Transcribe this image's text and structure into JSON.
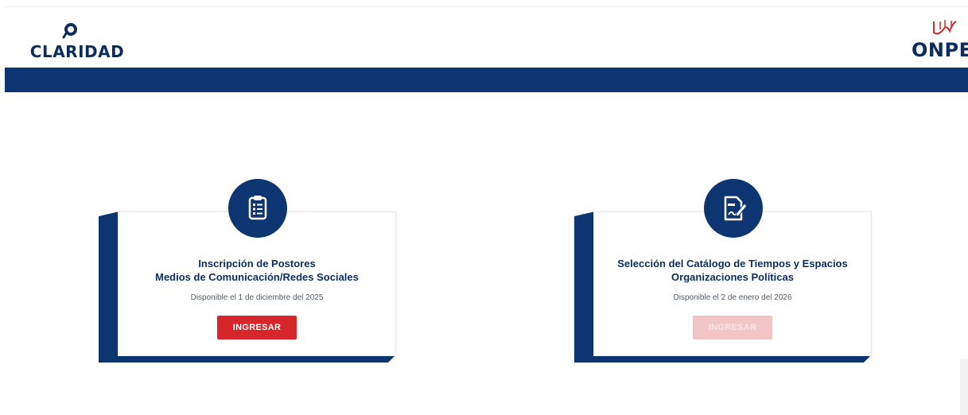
{
  "header": {
    "left_logo": {
      "text": "CLARIDAD",
      "icon": "magnifier-logo-icon"
    },
    "right_logo": {
      "text": "ONPE",
      "icon": "onpe-emblem-icon"
    }
  },
  "colors": {
    "navy": "#0d3572",
    "red": "#d7262b",
    "red_disabled": "#f3c4c6"
  },
  "cards": [
    {
      "icon": "clipboard-list-icon",
      "title_line1": "Inscripción de Postores",
      "title_line2": "Medios de Comunicación/Redes Sociales",
      "availability": "Disponible el 1 de diciembre del 2025",
      "button_label": "INGRESAR",
      "button_enabled": true
    },
    {
      "icon": "document-signature-icon",
      "title_line1": "Selección del Catálogo de Tiempos y Espacios",
      "title_line2": "Organizaciones Políticas",
      "availability": "Disponible el 2 de enero del 2026",
      "button_label": "INGRESAR",
      "button_enabled": false
    }
  ]
}
